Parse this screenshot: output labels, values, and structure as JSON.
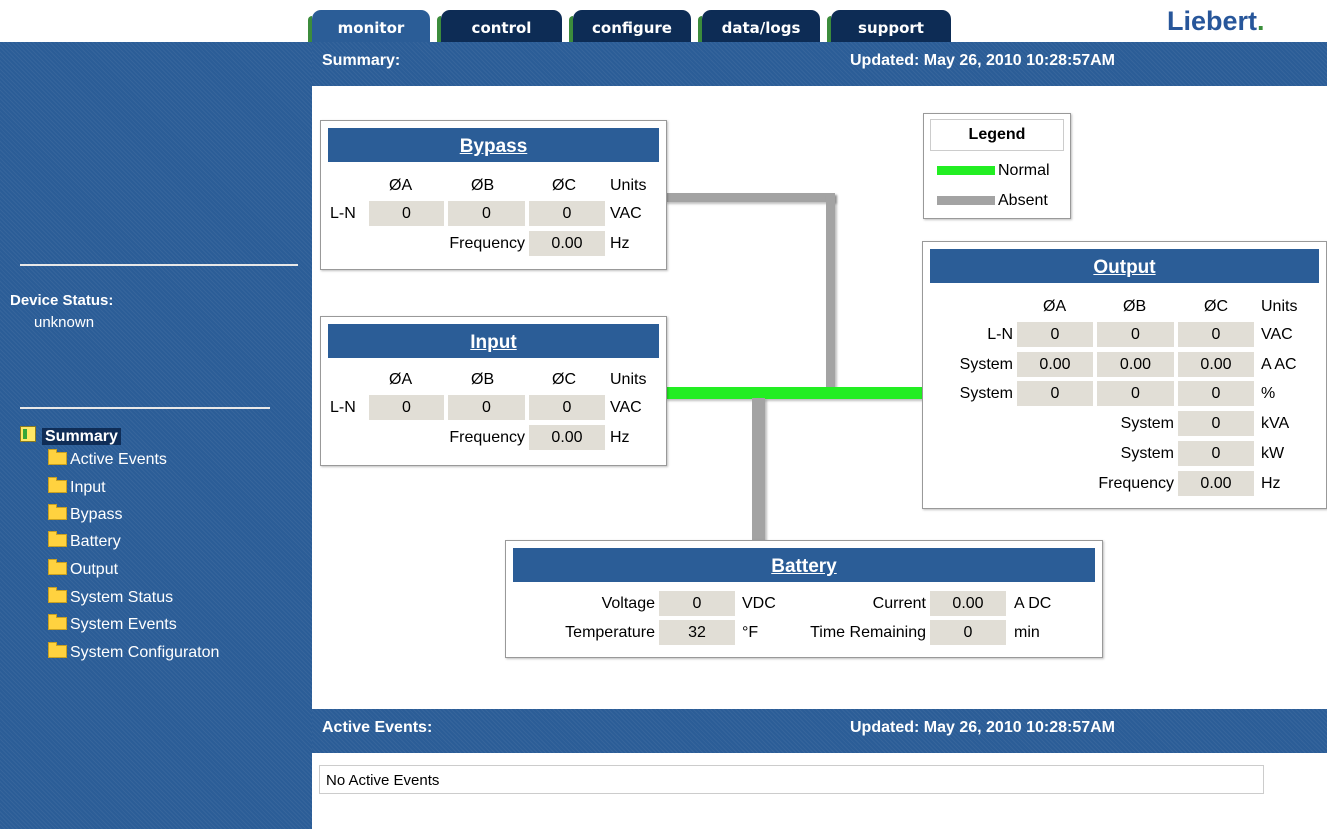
{
  "tabs": [
    {
      "label": "monitor",
      "active": true
    },
    {
      "label": "control",
      "active": false
    },
    {
      "label": "configure",
      "active": false
    },
    {
      "label": "data/logs",
      "active": false
    },
    {
      "label": "support",
      "active": false
    }
  ],
  "brand": {
    "name": "Liebert",
    "dot": "."
  },
  "summary_bar": {
    "title": "Summary:",
    "updated": "Updated: May 26, 2010 10:28:57AM"
  },
  "events_bar": {
    "title": "Active Events:",
    "updated": "Updated: May 26, 2010 10:28:57AM"
  },
  "events": {
    "message": "No Active Events"
  },
  "sidebar": {
    "device_status_label": "Device Status:",
    "device_status_value": "unknown",
    "tree": {
      "root": "Summary",
      "items": [
        "Active Events",
        "Input",
        "Bypass",
        "Battery",
        "Output",
        "System Status",
        "System Events",
        "System Configuraton"
      ]
    }
  },
  "legend": {
    "title": "Legend",
    "normal": "Normal",
    "absent": "Absent",
    "colors": {
      "normal": "#22ee22",
      "absent": "#a3a3a3"
    }
  },
  "phase_headers": {
    "a": "ØA",
    "b": "ØB",
    "c": "ØC",
    "units": "Units"
  },
  "bypass": {
    "title": "Bypass",
    "ln_label": "L-N",
    "ln": [
      "0",
      "0",
      "0"
    ],
    "ln_unit": "VAC",
    "freq_label": "Frequency",
    "freq": "0.00",
    "freq_unit": "Hz"
  },
  "input": {
    "title": "Input",
    "ln_label": "L-N",
    "ln": [
      "0",
      "0",
      "0"
    ],
    "ln_unit": "VAC",
    "freq_label": "Frequency",
    "freq": "0.00",
    "freq_unit": "Hz"
  },
  "output": {
    "title": "Output",
    "rows": [
      {
        "label": "L-N",
        "values": [
          "0",
          "0",
          "0"
        ],
        "unit": "VAC"
      },
      {
        "label": "System",
        "values": [
          "0.00",
          "0.00",
          "0.00"
        ],
        "unit": "A AC"
      },
      {
        "label": "System",
        "values": [
          "0",
          "0",
          "0"
        ],
        "unit": "%"
      }
    ],
    "single": [
      {
        "label": "System",
        "value": "0",
        "unit": "kVA"
      },
      {
        "label": "System",
        "value": "0",
        "unit": "kW"
      },
      {
        "label": "Frequency",
        "value": "0.00",
        "unit": "Hz"
      }
    ]
  },
  "battery": {
    "title": "Battery",
    "voltage_label": "Voltage",
    "voltage": "0",
    "voltage_unit": "VDC",
    "current_label": "Current",
    "current": "0.00",
    "current_unit": "A DC",
    "temp_label": "Temperature",
    "temp": "32",
    "temp_unit": "°F",
    "time_label": "Time Remaining",
    "time": "0",
    "time_unit": "min"
  }
}
